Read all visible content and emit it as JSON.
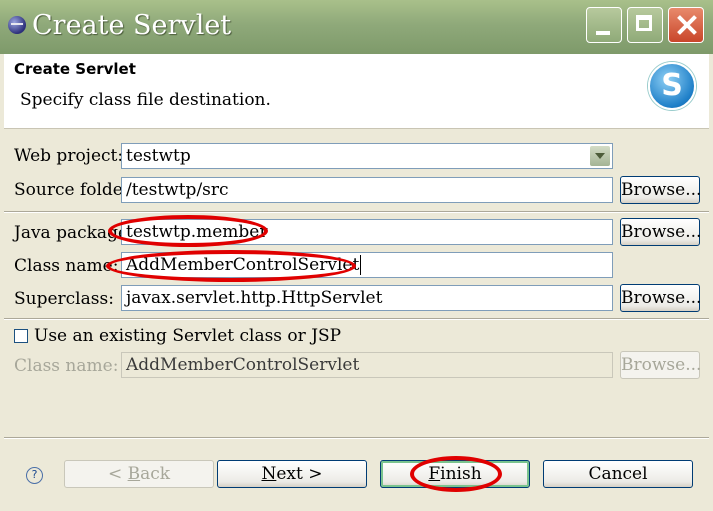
{
  "window": {
    "title": "Create Servlet"
  },
  "banner": {
    "heading": "Create Servlet",
    "description": "Specify class file destination."
  },
  "form": {
    "web_project_label": "Web project:",
    "web_project_value": "testwtp",
    "source_folder_label": "Source folder:",
    "source_folder_value": "/testwtp/src",
    "java_package_label": "Java package:",
    "java_package_value": "testwtp.member",
    "class_name_label": "Class name:",
    "class_name_value": "AddMemberControlServlet",
    "superclass_label": "Superclass:",
    "superclass_value": "javax.servlet.http.HttpServlet",
    "browse_label": "Browse...",
    "use_existing_label": "Use an existing Servlet class or JSP",
    "use_existing_checked": false,
    "existing_class_label": "Class name:",
    "existing_class_value": "AddMemberControlServlet"
  },
  "buttons": {
    "back_prefix": "< ",
    "back_mnemonic": "B",
    "back_rest": "ack",
    "next_mnemonic": "N",
    "next_rest": "ext >",
    "finish_mnemonic": "F",
    "finish_rest": "inish",
    "cancel": "Cancel",
    "help": "?"
  },
  "colors": {
    "annotation": "#e00000",
    "title_bar": "#8fa97a"
  }
}
